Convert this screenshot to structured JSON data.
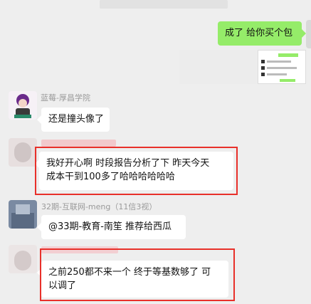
{
  "messages": {
    "m1": {
      "text": "成了 给你买个包"
    },
    "m2": {
      "sender": "蓝莓-厚昌学院",
      "text": "还是撞头像了"
    },
    "m3": {
      "line1": "我好开心啊 时段报告分析了下 昨天今天",
      "line2": "成本干到100多了哈哈哈哈哈哈"
    },
    "m4": {
      "sender": "32期-互联网-meng（11信3视）",
      "text": "@33期-教育-南笙 推荐给西瓜"
    },
    "m5": {
      "line1": "之前250都不来一个 终于等基数够了 可",
      "line2": "以调了"
    }
  },
  "colors": {
    "chat_bg": "#eeeeee",
    "self_bubble": "#95ec69",
    "other_bubble": "#ffffff",
    "highlight": "#e8302a"
  }
}
